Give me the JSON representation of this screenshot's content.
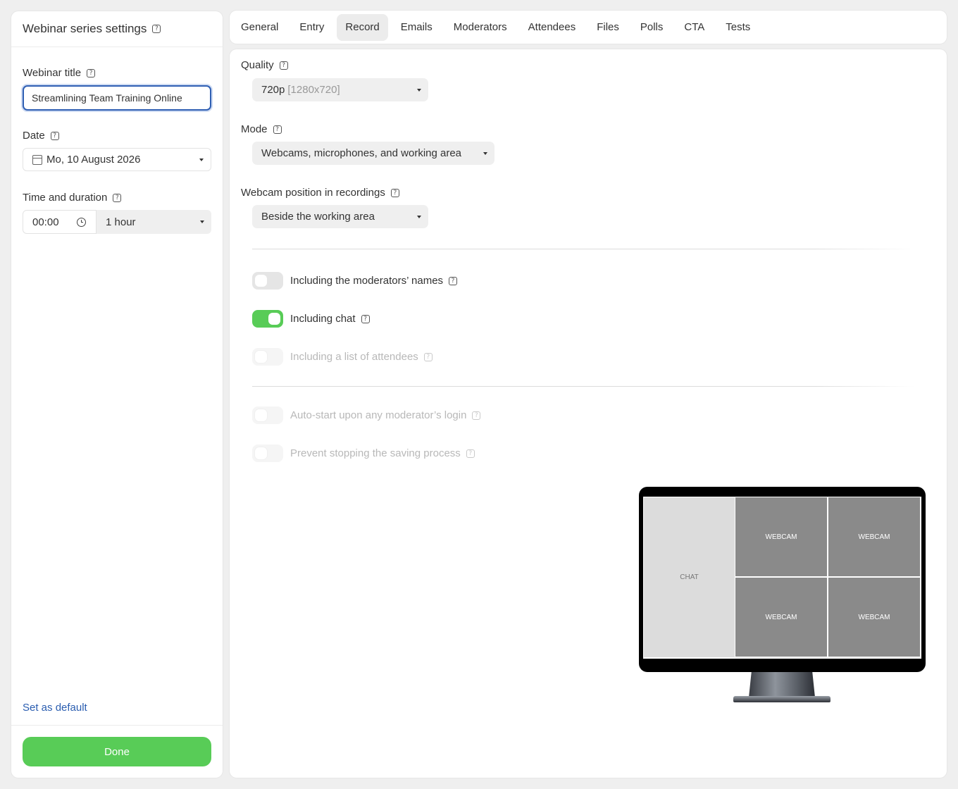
{
  "sidebar": {
    "title": "Webinar series settings",
    "webinar_title_label": "Webinar title",
    "webinar_title_value": "Streamlining Team Training Online",
    "date_label": "Date",
    "date_value": "Mo, 10 August 2026",
    "time_label": "Time and duration",
    "time_value": "00:00",
    "duration_value": "1 hour",
    "set_default": "Set as default",
    "done": "Done"
  },
  "tabs": [
    {
      "label": "General"
    },
    {
      "label": "Entry"
    },
    {
      "label": "Record",
      "active": true
    },
    {
      "label": "Emails"
    },
    {
      "label": "Moderators"
    },
    {
      "label": "Attendees"
    },
    {
      "label": "Files"
    },
    {
      "label": "Polls"
    },
    {
      "label": "CTA"
    },
    {
      "label": "Tests"
    }
  ],
  "record": {
    "quality_label": "Quality",
    "quality_value": "720p",
    "quality_resolution": "[1280x720]",
    "mode_label": "Mode",
    "mode_value": "Webcams, microphones, and working area",
    "webcam_position_label": "Webcam position in recordings",
    "webcam_position_value": "Beside the working area",
    "toggles": [
      {
        "label": "Including the moderators’ names",
        "on": false,
        "disabled": false
      },
      {
        "label": "Including chat",
        "on": true,
        "disabled": false
      },
      {
        "label": "Including a list of attendees",
        "on": false,
        "disabled": true
      },
      {
        "label": "Auto-start upon any moderator’s login",
        "on": false,
        "disabled": true
      },
      {
        "label": "Prevent stopping the saving process",
        "on": false,
        "disabled": true
      }
    ],
    "preview": {
      "chat": "CHAT",
      "webcams": [
        "WEBCAM",
        "WEBCAM",
        "WEBCAM",
        "WEBCAM"
      ]
    }
  },
  "colors": {
    "accent_green": "#58cc57",
    "link_blue": "#2a5db0",
    "focus_blue": "#2f5fb3"
  },
  "icons": {
    "help": "question-mark-square",
    "calendar": "calendar-icon",
    "clock": "clock-icon",
    "dropdown": "caret-down-icon"
  }
}
